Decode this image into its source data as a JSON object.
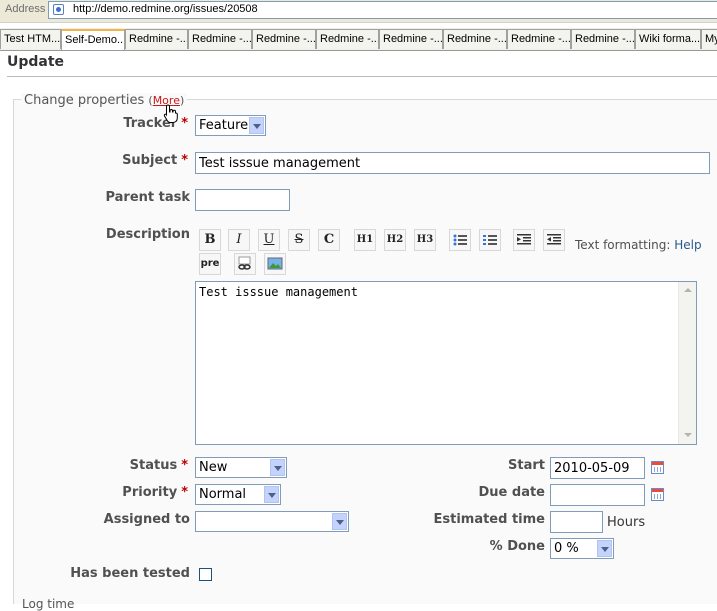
{
  "browser": {
    "address_label": "Address",
    "url": "http://demo.redmine.org/issues/20508",
    "tabs": [
      "Test HTM...",
      "Self-Demo...",
      "Redmine -...",
      "Redmine -...",
      "Redmine -...",
      "Redmine -...",
      "Redmine -...",
      "Redmine -...",
      "Redmine -...",
      "Redmine -...",
      "Wiki forma...",
      "My"
    ],
    "active_tab": 1
  },
  "page": {
    "heading": "Update",
    "fieldset_legend": "Change properties",
    "more_link": "More",
    "open_paren": "(",
    "close_paren": ")",
    "required_mark": "*",
    "bottom_partial_text": "Log time"
  },
  "fields": {
    "tracker": {
      "label": "Tracker",
      "value": "Feature"
    },
    "subject": {
      "label": "Subject",
      "value": "Test isssue management"
    },
    "parent_task": {
      "label": "Parent task",
      "value": ""
    },
    "description": {
      "label": "Description",
      "value": "Test isssue management"
    },
    "status": {
      "label": "Status",
      "value": "New"
    },
    "priority": {
      "label": "Priority",
      "value": "Normal"
    },
    "assigned_to": {
      "label": "Assigned to",
      "value": ""
    },
    "start": {
      "label": "Start",
      "value": "2010-05-09"
    },
    "due_date": {
      "label": "Due date",
      "value": ""
    },
    "estimated_time": {
      "label": "Estimated time",
      "value": "",
      "unit": "Hours"
    },
    "done": {
      "label": "% Done",
      "value": "0 %"
    },
    "has_been_tested": {
      "label": "Has been tested",
      "checked": false
    }
  },
  "toolbar": {
    "bold": "B",
    "italic": "I",
    "underline": "U",
    "strike": "S",
    "code": "C",
    "h1": "H1",
    "h2": "H2",
    "h3": "H3",
    "pre": "pre",
    "text_formatting_label": "Text formatting:",
    "help_link": "Help"
  }
}
